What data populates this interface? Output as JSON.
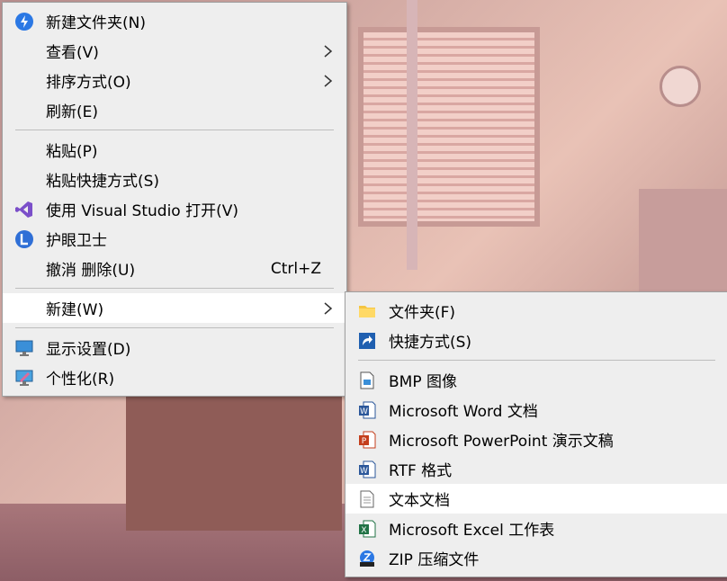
{
  "context_menu": {
    "items": [
      {
        "label": "新建文件夹(N)"
      },
      {
        "label": "查看(V)"
      },
      {
        "label": "排序方式(O)"
      },
      {
        "label": "刷新(E)"
      },
      {
        "label": "粘贴(P)"
      },
      {
        "label": "粘贴快捷方式(S)"
      },
      {
        "label": "使用 Visual Studio 打开(V)"
      },
      {
        "label": "护眼卫士"
      },
      {
        "label": "撤消 删除(U)",
        "shortcut": "Ctrl+Z"
      },
      {
        "label": "新建(W)"
      },
      {
        "label": "显示设置(D)"
      },
      {
        "label": "个性化(R)"
      }
    ]
  },
  "new_submenu": {
    "items": [
      {
        "label": "文件夹(F)"
      },
      {
        "label": "快捷方式(S)"
      },
      {
        "label": "BMP 图像"
      },
      {
        "label": "Microsoft Word 文档"
      },
      {
        "label": "Microsoft PowerPoint 演示文稿"
      },
      {
        "label": "RTF 格式"
      },
      {
        "label": "文本文档"
      },
      {
        "label": "Microsoft Excel 工作表"
      },
      {
        "label": "ZIP 压缩文件"
      }
    ]
  }
}
